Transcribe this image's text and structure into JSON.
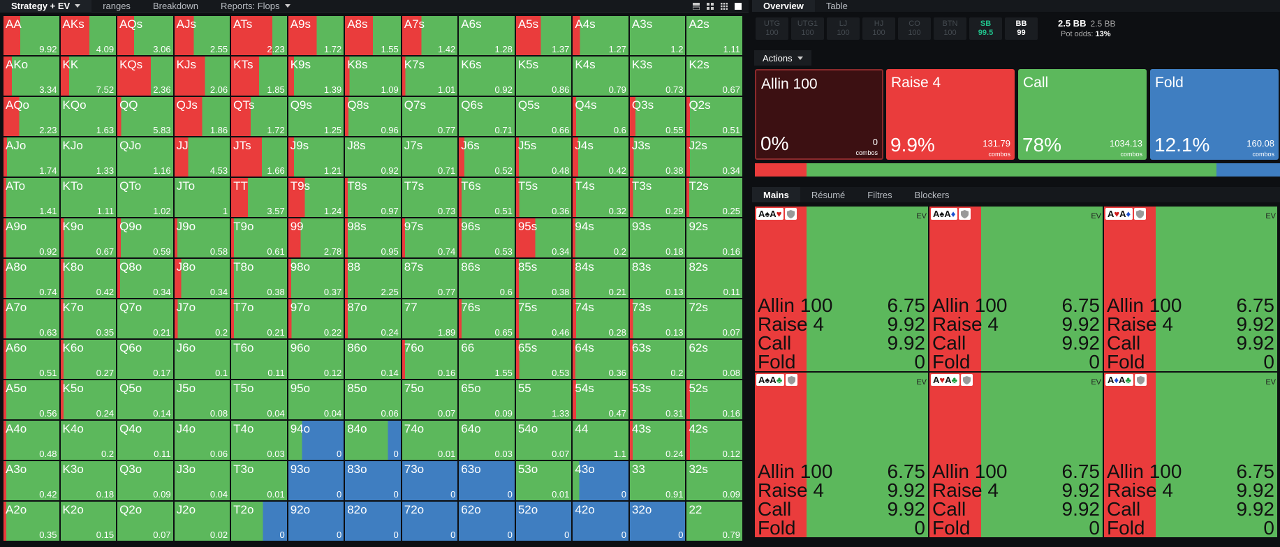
{
  "topbar": {
    "tabs": [
      "Strategy + EV",
      "ranges",
      "Breakdown",
      "Reports: Flops"
    ]
  },
  "right_tabs": [
    "Overview",
    "Table"
  ],
  "seats": [
    {
      "name": "UTG",
      "stack": "100"
    },
    {
      "name": "UTG1",
      "stack": "100"
    },
    {
      "name": "LJ",
      "stack": "100"
    },
    {
      "name": "HJ",
      "stack": "100"
    },
    {
      "name": "CO",
      "stack": "100"
    },
    {
      "name": "BTN",
      "stack": "100"
    },
    {
      "name": "SB",
      "stack": "99.5"
    },
    {
      "name": "BB",
      "stack": "99"
    }
  ],
  "pot": {
    "bb": "2.5 BB",
    "bb2": "2.5 BB",
    "odds_label": "Pot odds:",
    "odds": "13%"
  },
  "actions_label": "Actions",
  "action_cards": [
    {
      "title": "Allin 100",
      "pct": "0%",
      "combos": "0",
      "unit": "combos",
      "bg": "#3c1012"
    },
    {
      "title": "Raise 4",
      "pct": "9.9%",
      "combos": "131.79",
      "unit": "combos",
      "bg": "#ea3c3c"
    },
    {
      "title": "Call",
      "pct": "78%",
      "combos": "1034.13",
      "unit": "combos",
      "bg": "#5cb85c"
    },
    {
      "title": "Fold",
      "pct": "12.1%",
      "combos": "160.08",
      "unit": "combos",
      "bg": "#3f7ec1"
    }
  ],
  "freq_bar": {
    "raise": 0.099,
    "call": 0.78,
    "fold": 0.121
  },
  "bottom_tabs": [
    "Mains",
    "Résumé",
    "Filtres",
    "Blockers"
  ],
  "colors": {
    "raise": "#ea3c3c",
    "call": "#5cb85c",
    "fold": "#3f7ec1"
  },
  "ev_label": "EV",
  "combos": [
    {
      "cards": [
        {
          "r": "A",
          "s": "♠",
          "c": "#111"
        },
        {
          "r": "A",
          "s": "♥",
          "c": "#d01b1b"
        }
      ],
      "rows": [
        [
          "Allin 100",
          "6.75"
        ],
        [
          "Raise 4",
          "9.92"
        ],
        [
          "Call",
          "9.92"
        ],
        [
          "Fold",
          "0"
        ]
      ]
    },
    {
      "cards": [
        {
          "r": "A",
          "s": "♠",
          "c": "#111"
        },
        {
          "r": "A",
          "s": "♦",
          "c": "#1b4fd0"
        }
      ],
      "rows": [
        [
          "Allin 100",
          "6.75"
        ],
        [
          "Raise 4",
          "9.92"
        ],
        [
          "Call",
          "9.92"
        ],
        [
          "Fold",
          "0"
        ]
      ]
    },
    {
      "cards": [
        {
          "r": "A",
          "s": "♥",
          "c": "#d01b1b"
        },
        {
          "r": "A",
          "s": "♦",
          "c": "#1b4fd0"
        }
      ],
      "rows": [
        [
          "Allin 100",
          "6.75"
        ],
        [
          "Raise 4",
          "9.92"
        ],
        [
          "Call",
          "9.92"
        ],
        [
          "Fold",
          "0"
        ]
      ]
    },
    {
      "cards": [
        {
          "r": "A",
          "s": "♠",
          "c": "#111"
        },
        {
          "r": "A",
          "s": "♣",
          "c": "#1a9a3a"
        }
      ],
      "rows": [
        [
          "Allin 100",
          "6.75"
        ],
        [
          "Raise 4",
          "9.92"
        ],
        [
          "Call",
          "9.92"
        ],
        [
          "Fold",
          "0"
        ]
      ]
    },
    {
      "cards": [
        {
          "r": "A",
          "s": "♥",
          "c": "#d01b1b"
        },
        {
          "r": "A",
          "s": "♣",
          "c": "#1a9a3a"
        }
      ],
      "rows": [
        [
          "Allin 100",
          "6.75"
        ],
        [
          "Raise 4",
          "9.92"
        ],
        [
          "Call",
          "9.92"
        ],
        [
          "Fold",
          "0"
        ]
      ]
    },
    {
      "cards": [
        {
          "r": "A",
          "s": "♦",
          "c": "#1b4fd0"
        },
        {
          "r": "A",
          "s": "♣",
          "c": "#1a9a3a"
        }
      ],
      "rows": [
        [
          "Allin 100",
          "6.75"
        ],
        [
          "Raise 4",
          "9.92"
        ],
        [
          "Call",
          "9.92"
        ],
        [
          "Fold",
          "0"
        ]
      ]
    }
  ],
  "grid": [
    [
      [
        "AA",
        "9.92",
        0.3,
        0.7,
        0
      ],
      [
        "AKs",
        "4.09",
        0.52,
        0.48,
        0
      ],
      [
        "AQs",
        "3.06",
        0.3,
        0.7,
        0
      ],
      [
        "AJs",
        "2.55",
        0.35,
        0.65,
        0
      ],
      [
        "ATs",
        "2.23",
        0.74,
        0.26,
        0
      ],
      [
        "A9s",
        "1.72",
        0.51,
        0.49,
        0
      ],
      [
        "A8s",
        "1.55",
        0.5,
        0.5,
        0
      ],
      [
        "A7s",
        "1.42",
        0.35,
        0.65,
        0
      ],
      [
        "A6s",
        "1.28",
        0,
        1,
        0
      ],
      [
        "A5s",
        "1.37",
        0.45,
        0.55,
        0
      ],
      [
        "A4s",
        "1.27",
        0.13,
        0.87,
        0
      ],
      [
        "A3s",
        "1.2",
        0,
        1,
        0
      ],
      [
        "A2s",
        "1.11",
        0,
        1,
        0
      ]
    ],
    [
      [
        "AKo",
        "3.34",
        0.15,
        0.85,
        0
      ],
      [
        "KK",
        "7.52",
        0.15,
        0.85,
        0
      ],
      [
        "KQs",
        "2.36",
        0.6,
        0.4,
        0
      ],
      [
        "KJs",
        "2.06",
        0.55,
        0.45,
        0
      ],
      [
        "KTs",
        "1.85",
        0.5,
        0.5,
        0
      ],
      [
        "K9s",
        "1.39",
        0.1,
        0.9,
        0
      ],
      [
        "K8s",
        "1.09",
        0.08,
        0.92,
        0
      ],
      [
        "K7s",
        "1.01",
        0.06,
        0.94,
        0
      ],
      [
        "K6s",
        "0.92",
        0,
        1,
        0
      ],
      [
        "K5s",
        "0.86",
        0,
        1,
        0
      ],
      [
        "K4s",
        "0.79",
        0,
        1,
        0
      ],
      [
        "K3s",
        "0.73",
        0,
        1,
        0
      ],
      [
        "K2s",
        "0.67",
        0,
        1,
        0
      ]
    ],
    [
      [
        "AQo",
        "2.23",
        0.28,
        0.72,
        0
      ],
      [
        "KQo",
        "1.63",
        0,
        1,
        0
      ],
      [
        "QQ",
        "5.83",
        0.07,
        0.93,
        0
      ],
      [
        "QJs",
        "1.86",
        0.5,
        0.5,
        0
      ],
      [
        "QTs",
        "1.72",
        0.35,
        0.65,
        0
      ],
      [
        "Q9s",
        "1.25",
        0,
        1,
        0
      ],
      [
        "Q8s",
        "0.96",
        0.06,
        0.94,
        0
      ],
      [
        "Q7s",
        "0.77",
        0,
        1,
        0
      ],
      [
        "Q6s",
        "0.71",
        0,
        1,
        0
      ],
      [
        "Q5s",
        "0.66",
        0,
        1,
        0
      ],
      [
        "Q4s",
        "0.6",
        0.06,
        0.94,
        0
      ],
      [
        "Q3s",
        "0.55",
        0.1,
        0.9,
        0
      ],
      [
        "Q2s",
        "0.51",
        0.06,
        0.94,
        0
      ]
    ],
    [
      [
        "AJo",
        "1.74",
        0.06,
        0.94,
        0
      ],
      [
        "KJo",
        "1.33",
        0,
        1,
        0
      ],
      [
        "QJo",
        "1.16",
        0,
        1,
        0
      ],
      [
        "JJ",
        "4.53",
        0.25,
        0.75,
        0
      ],
      [
        "JTs",
        "1.66",
        0.55,
        0.45,
        0
      ],
      [
        "J9s",
        "1.21",
        0.1,
        0.9,
        0
      ],
      [
        "J8s",
        "0.92",
        0,
        1,
        0
      ],
      [
        "J7s",
        "0.71",
        0,
        1,
        0
      ],
      [
        "J6s",
        "0.52",
        0.1,
        0.9,
        0
      ],
      [
        "J5s",
        "0.48",
        0.05,
        0.95,
        0
      ],
      [
        "J4s",
        "0.42",
        0.1,
        0.9,
        0
      ],
      [
        "J3s",
        "0.38",
        0.07,
        0.93,
        0
      ],
      [
        "J2s",
        "0.34",
        0.06,
        0.94,
        0
      ]
    ],
    [
      [
        "ATo",
        "1.41",
        0.05,
        0.95,
        0
      ],
      [
        "KTo",
        "1.11",
        0,
        1,
        0
      ],
      [
        "QTo",
        "1.02",
        0,
        1,
        0
      ],
      [
        "JTo",
        "1",
        0,
        1,
        0
      ],
      [
        "TT",
        "3.57",
        0.3,
        0.7,
        0
      ],
      [
        "T9s",
        "1.24",
        0.3,
        0.7,
        0
      ],
      [
        "T8s",
        "0.97",
        0.05,
        0.95,
        0
      ],
      [
        "T7s",
        "0.73",
        0,
        1,
        0
      ],
      [
        "T6s",
        "0.51",
        0.05,
        0.95,
        0
      ],
      [
        "T5s",
        "0.36",
        0.06,
        0.94,
        0
      ],
      [
        "T4s",
        "0.32",
        0.06,
        0.94,
        0
      ],
      [
        "T3s",
        "0.29",
        0.06,
        0.94,
        0
      ],
      [
        "T2s",
        "0.25",
        0.05,
        0.95,
        0
      ]
    ],
    [
      [
        "A9o",
        "0.92",
        0.05,
        0.95,
        0
      ],
      [
        "K9o",
        "0.67",
        0.06,
        0.94,
        0
      ],
      [
        "Q9o",
        "0.59",
        0.06,
        0.94,
        0
      ],
      [
        "J9o",
        "0.58",
        0.05,
        0.95,
        0
      ],
      [
        "T9o",
        "0.61",
        0.05,
        0.95,
        0
      ],
      [
        "99",
        "2.78",
        0.22,
        0.78,
        0
      ],
      [
        "98s",
        "0.95",
        0.05,
        0.95,
        0
      ],
      [
        "97s",
        "0.74",
        0.05,
        0.95,
        0
      ],
      [
        "96s",
        "0.53",
        0.05,
        0.95,
        0
      ],
      [
        "95s",
        "0.34",
        0.35,
        0.65,
        0
      ],
      [
        "94s",
        "0.2",
        0.05,
        0.95,
        0
      ],
      [
        "93s",
        "0.18",
        0,
        1,
        0
      ],
      [
        "92s",
        "0.16",
        0,
        1,
        0
      ]
    ],
    [
      [
        "A8o",
        "0.74",
        0.05,
        0.95,
        0
      ],
      [
        "K8o",
        "0.42",
        0.06,
        0.94,
        0
      ],
      [
        "Q8o",
        "0.34",
        0.05,
        0.95,
        0
      ],
      [
        "J8o",
        "0.34",
        0.12,
        0.88,
        0
      ],
      [
        "T8o",
        "0.38",
        0.05,
        0.95,
        0
      ],
      [
        "98o",
        "0.37",
        0.05,
        0.95,
        0
      ],
      [
        "88",
        "2.25",
        0.05,
        0.95,
        0
      ],
      [
        "87s",
        "0.77",
        0,
        1,
        0
      ],
      [
        "86s",
        "0.6",
        0,
        1,
        0
      ],
      [
        "85s",
        "0.38",
        0.05,
        0.95,
        0
      ],
      [
        "84s",
        "0.21",
        0.05,
        0.95,
        0
      ],
      [
        "83s",
        "0.13",
        0,
        1,
        0
      ],
      [
        "82s",
        "0.11",
        0,
        1,
        0
      ]
    ],
    [
      [
        "A7o",
        "0.63",
        0.05,
        0.95,
        0
      ],
      [
        "K7o",
        "0.35",
        0.05,
        0.95,
        0
      ],
      [
        "Q7o",
        "0.21",
        0,
        1,
        0
      ],
      [
        "J7o",
        "0.2",
        0.06,
        0.94,
        0
      ],
      [
        "T7o",
        "0.21",
        0.05,
        0.95,
        0
      ],
      [
        "97o",
        "0.22",
        0.06,
        0.94,
        0
      ],
      [
        "87o",
        "0.24",
        0.05,
        0.95,
        0
      ],
      [
        "77",
        "1.89",
        0,
        1,
        0
      ],
      [
        "76s",
        "0.65",
        0.05,
        0.95,
        0
      ],
      [
        "75s",
        "0.46",
        0.05,
        0.95,
        0
      ],
      [
        "74s",
        "0.28",
        0.06,
        0.94,
        0
      ],
      [
        "73s",
        "0.13",
        0.06,
        0.94,
        0
      ],
      [
        "72s",
        "0.07",
        0,
        1,
        0
      ]
    ],
    [
      [
        "A6o",
        "0.51",
        0.05,
        0.95,
        0
      ],
      [
        "K6o",
        "0.27",
        0.05,
        0.95,
        0
      ],
      [
        "Q6o",
        "0.17",
        0,
        1,
        0
      ],
      [
        "J6o",
        "0.1",
        0,
        1,
        0
      ],
      [
        "T6o",
        "0.11",
        0,
        1,
        0
      ],
      [
        "96o",
        "0.12",
        0,
        1,
        0
      ],
      [
        "86o",
        "0.14",
        0,
        1,
        0
      ],
      [
        "76o",
        "0.16",
        0.05,
        0.95,
        0
      ],
      [
        "66",
        "1.55",
        0,
        1,
        0
      ],
      [
        "65s",
        "0.53",
        0.06,
        0.94,
        0
      ],
      [
        "64s",
        "0.36",
        0.05,
        0.95,
        0
      ],
      [
        "63s",
        "0.2",
        0.05,
        0.95,
        0
      ],
      [
        "62s",
        "0.08",
        0,
        1,
        0
      ]
    ],
    [
      [
        "A5o",
        "0.56",
        0.05,
        0.95,
        0
      ],
      [
        "K5o",
        "0.24",
        0.05,
        0.95,
        0
      ],
      [
        "Q5o",
        "0.14",
        0,
        1,
        0
      ],
      [
        "J5o",
        "0.08",
        0,
        1,
        0
      ],
      [
        "T5o",
        "0.04",
        0,
        1,
        0
      ],
      [
        "95o",
        "0.04",
        0,
        1,
        0
      ],
      [
        "85o",
        "0.06",
        0,
        1,
        0
      ],
      [
        "75o",
        "0.07",
        0,
        1,
        0
      ],
      [
        "65o",
        "0.09",
        0,
        1,
        0
      ],
      [
        "55",
        "1.33",
        0,
        1,
        0
      ],
      [
        "54s",
        "0.47",
        0.06,
        0.94,
        0
      ],
      [
        "53s",
        "0.31",
        0.05,
        0.95,
        0
      ],
      [
        "52s",
        "0.16",
        0.06,
        0.94,
        0
      ]
    ],
    [
      [
        "A4o",
        "0.48",
        0.05,
        0.95,
        0
      ],
      [
        "K4o",
        "0.2",
        0,
        1,
        0
      ],
      [
        "Q4o",
        "0.11",
        0,
        1,
        0
      ],
      [
        "J4o",
        "0.06",
        0,
        1,
        0
      ],
      [
        "T4o",
        "0.03",
        0,
        1,
        0
      ],
      [
        "94o",
        "0",
        0,
        0.25,
        0.75
      ],
      [
        "84o",
        "0",
        0,
        0.77,
        0.23
      ],
      [
        "74o",
        "0.01",
        0,
        1,
        0
      ],
      [
        "64o",
        "0.03",
        0,
        1,
        0
      ],
      [
        "54o",
        "0.07",
        0,
        1,
        0
      ],
      [
        "44",
        "1.1",
        0,
        1,
        0
      ],
      [
        "43s",
        "0.24",
        0.05,
        0.95,
        0
      ],
      [
        "42s",
        "0.12",
        0.06,
        0.94,
        0
      ]
    ],
    [
      [
        "A3o",
        "0.42",
        0.05,
        0.95,
        0
      ],
      [
        "K3o",
        "0.18",
        0,
        1,
        0
      ],
      [
        "Q3o",
        "0.09",
        0,
        1,
        0
      ],
      [
        "J3o",
        "0.04",
        0,
        1,
        0
      ],
      [
        "T3o",
        "0.01",
        0,
        1,
        0
      ],
      [
        "93o",
        "0",
        0,
        0,
        1
      ],
      [
        "83o",
        "0",
        0,
        0,
        1
      ],
      [
        "73o",
        "0",
        0,
        0,
        1
      ],
      [
        "63o",
        "0",
        0,
        0,
        1
      ],
      [
        "53o",
        "0.01",
        0,
        1,
        0
      ],
      [
        "43o",
        "0",
        0,
        0.12,
        0.88
      ],
      [
        "33",
        "0.91",
        0,
        1,
        0
      ],
      [
        "32s",
        "0.09",
        0,
        1,
        0
      ]
    ],
    [
      [
        "A2o",
        "0.35",
        0.05,
        0.95,
        0
      ],
      [
        "K2o",
        "0.15",
        0,
        1,
        0
      ],
      [
        "Q2o",
        "0.07",
        0,
        1,
        0
      ],
      [
        "J2o",
        "0.02",
        0,
        1,
        0
      ],
      [
        "T2o",
        "0",
        0,
        0.57,
        0.43
      ],
      [
        "92o",
        "0",
        0,
        0,
        1
      ],
      [
        "82o",
        "0",
        0,
        0,
        1
      ],
      [
        "72o",
        "0",
        0,
        0,
        1
      ],
      [
        "62o",
        "0",
        0,
        0,
        1
      ],
      [
        "52o",
        "0",
        0,
        0,
        1
      ],
      [
        "42o",
        "0",
        0,
        0,
        1
      ],
      [
        "32o",
        "0",
        0,
        0,
        1
      ],
      [
        "22",
        "0.79",
        0,
        1,
        0
      ]
    ]
  ]
}
